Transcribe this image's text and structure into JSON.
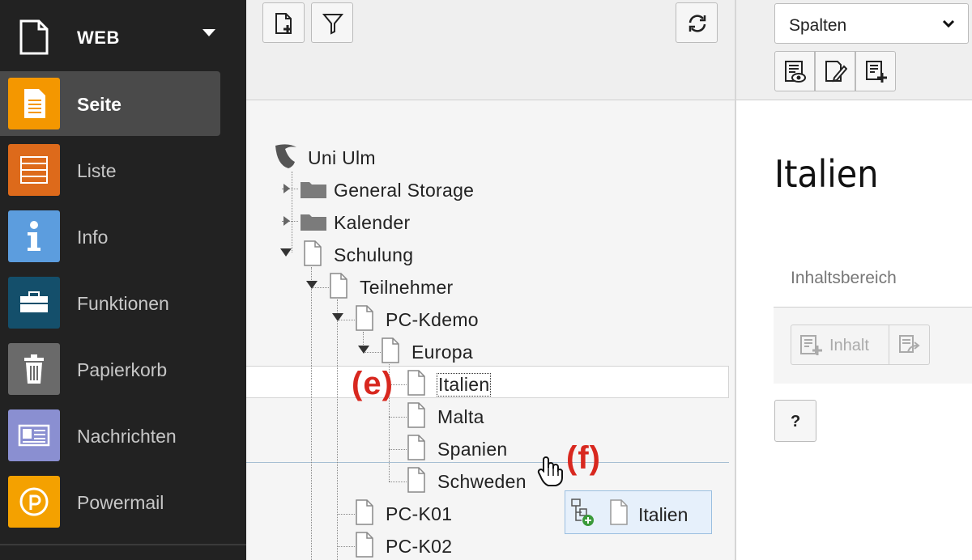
{
  "modules": {
    "group": {
      "title": "WEB",
      "icon": "document-icon"
    },
    "items": [
      {
        "label": "Seite",
        "icon": "page-icon",
        "color": "#f49700",
        "active": true
      },
      {
        "label": "Liste",
        "icon": "list-icon",
        "color": "#dd6a1b",
        "active": false
      },
      {
        "label": "Info",
        "icon": "info-icon",
        "color": "#5c9dde",
        "active": false
      },
      {
        "label": "Funktionen",
        "icon": "toolbox-icon",
        "color": "#144f6b",
        "active": false
      },
      {
        "label": "Papierkorb",
        "icon": "trash-icon",
        "color": "#6a6a6a",
        "active": false
      },
      {
        "label": "Nachrichten",
        "icon": "newspaper-icon",
        "color": "#8a8fd1",
        "active": false
      },
      {
        "label": "Powermail",
        "icon": "powermail-icon",
        "color": "#f4a100",
        "active": false
      }
    ]
  },
  "tree": {
    "root": "Uni Ulm",
    "nodes": {
      "general_storage": "General Storage",
      "kalender": "Kalender",
      "schulung": "Schulung",
      "teilnehmer": "Teilnehmer",
      "pc_kdemo": "PC-Kdemo",
      "europa": "Europa",
      "italien": "Italien",
      "malta": "Malta",
      "spanien": "Spanien",
      "schweden": "Schweden",
      "pc_k01": "PC-K01",
      "pc_k02": "PC-K02"
    },
    "drag_label": "Italien"
  },
  "annotations": {
    "e": "(e)",
    "f": "(f)"
  },
  "colors": {
    "annotation": "#d8281f",
    "sidebar_bg": "#222222",
    "drop_line": "#a7bfd3"
  },
  "content": {
    "view_select": "Spalten",
    "title": "Italien",
    "column_header": "Inhaltsbereich",
    "new_content_label": "Inhalt",
    "help_label": "?"
  }
}
